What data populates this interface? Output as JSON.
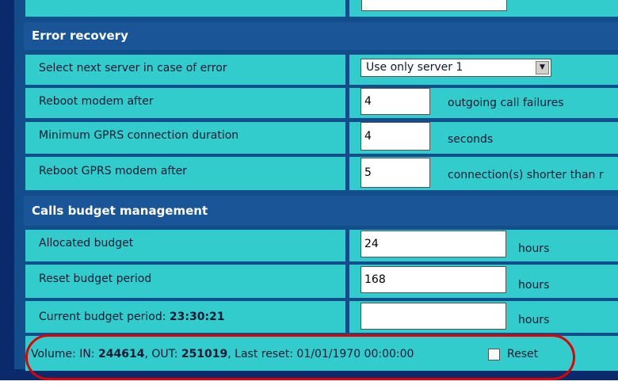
{
  "sections": {
    "error_recovery": "Error recovery",
    "calls_budget": "Calls budget management"
  },
  "error_recovery": {
    "select_server_label": "Select next server in case of error",
    "select_server_value": "Use only server 1",
    "reboot_modem_label": "Reboot modem after",
    "reboot_modem_value": "4",
    "reboot_modem_unit": "outgoing call failures",
    "min_gprs_label": "Minimum GPRS connection duration",
    "min_gprs_value": "4",
    "min_gprs_unit": "seconds",
    "reboot_gprs_label": "Reboot GPRS modem after",
    "reboot_gprs_value": "5",
    "reboot_gprs_unit": "connection(s) shorter than r"
  },
  "calls_budget": {
    "allocated_label": "Allocated budget",
    "allocated_value": "24",
    "allocated_unit": "hours",
    "reset_period_label": "Reset budget period",
    "reset_period_value": "168",
    "reset_period_unit": "hours",
    "current_period_label": "Current budget period:",
    "current_period_value": "23:30:21",
    "current_period_input": "",
    "current_period_unit": "hours"
  },
  "volume": {
    "prefix": "Volume: IN:",
    "in_value": "244614",
    "out_label": ", OUT:",
    "out_value": "251019",
    "last_reset_label": ", Last reset: 01/01/1970 00:00:00",
    "reset_label": "Reset"
  },
  "colors": {
    "accent_oval": "#e00000",
    "cell_bg": "#33cccc",
    "section_bg": "#1a5597"
  }
}
